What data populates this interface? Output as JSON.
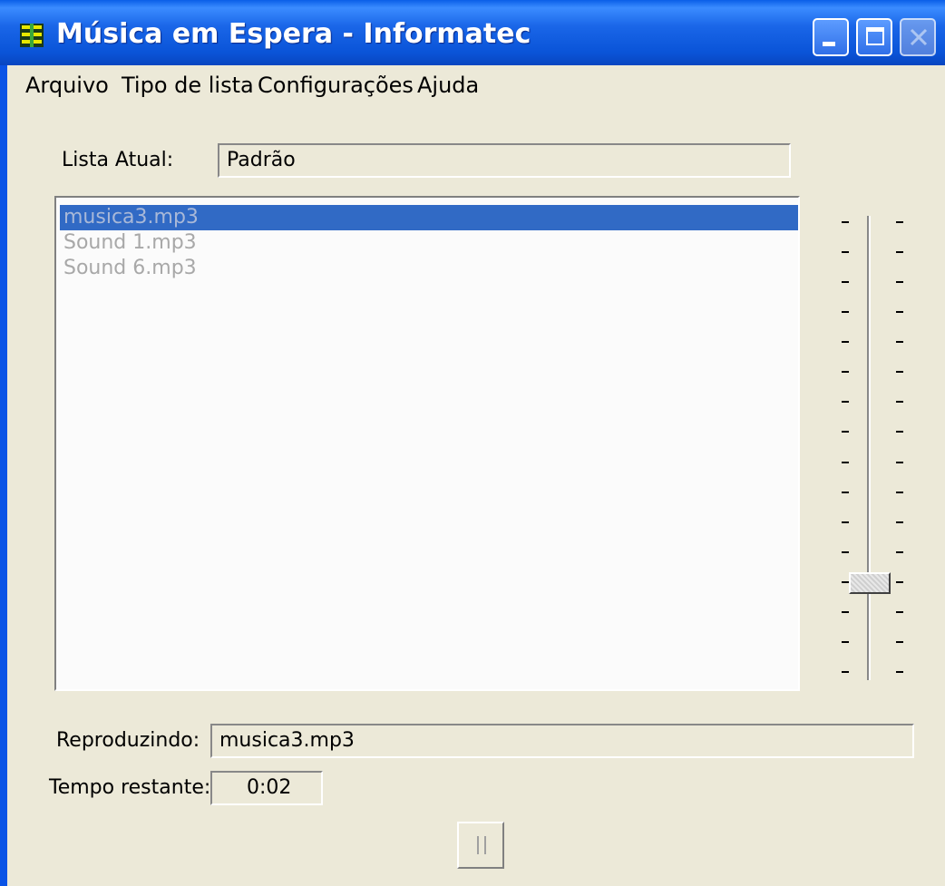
{
  "window": {
    "title": "Música em Espera - Informatec",
    "controls": {
      "minimize_icon": "minimize-icon",
      "maximize_icon": "maximize-icon",
      "close_icon": "close-icon"
    }
  },
  "menu": {
    "items": [
      {
        "label": "Arquivo"
      },
      {
        "label": "Tipo de lista"
      },
      {
        "label": "Configurações"
      },
      {
        "label": "Ajuda"
      }
    ]
  },
  "current_list": {
    "label": "Lista Atual:",
    "value": "Padrão"
  },
  "playlist": {
    "items": [
      {
        "name": "musica3.mp3",
        "selected": true
      },
      {
        "name": "Sound 1.mp3",
        "selected": false
      },
      {
        "name": "Sound 6.mp3",
        "selected": false
      }
    ]
  },
  "volume": {
    "level_fraction": 0.2,
    "tick_count": 16
  },
  "now_playing": {
    "label": "Reproduzindo:",
    "value": "musica3.mp3"
  },
  "time_remaining": {
    "label": "Tempo restante:",
    "value": "0:02"
  },
  "controls": {
    "pause_icon": "pause-icon"
  },
  "colors": {
    "titlebar": "#0a54d8",
    "selection": "#316ac5",
    "window_bg": "#ece9d8"
  }
}
